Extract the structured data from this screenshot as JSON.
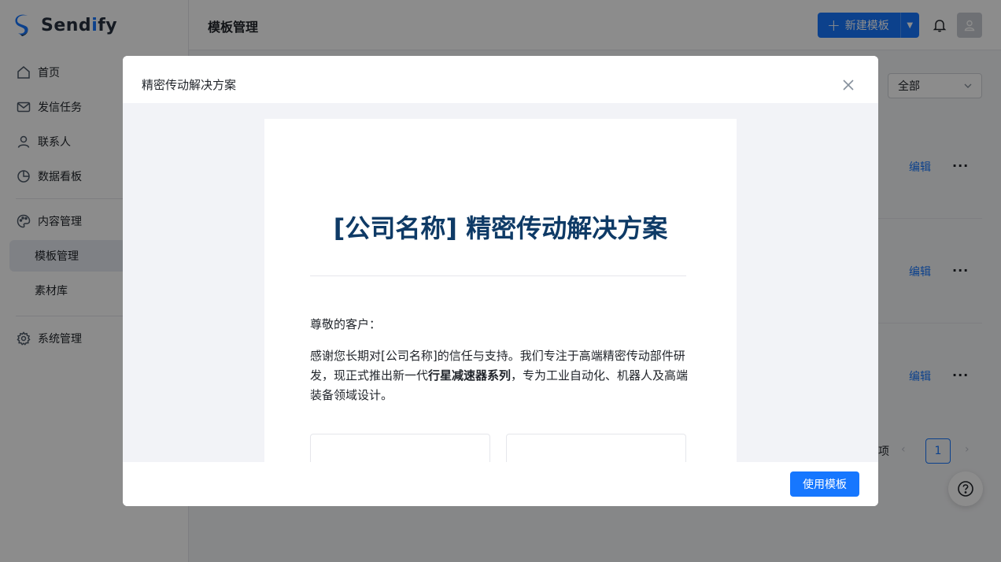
{
  "app": {
    "name_prefix": "Send",
    "name_accent": "i",
    "name_suffix": "fy"
  },
  "sidebar": {
    "items": [
      {
        "label": "首页",
        "icon": "home-icon"
      },
      {
        "label": "发信任务",
        "icon": "mail-icon"
      },
      {
        "label": "联系人",
        "icon": "user-icon"
      },
      {
        "label": "数据看板",
        "icon": "pie-chart-icon"
      },
      {
        "label": "内容管理",
        "icon": "palette-icon"
      },
      {
        "label": "模板管理",
        "sub": true,
        "active": true
      },
      {
        "label": "素材库",
        "sub": true
      },
      {
        "label": "系统管理",
        "icon": "gear-icon"
      }
    ]
  },
  "header": {
    "title": "模板管理",
    "new_button": "新建模板"
  },
  "content": {
    "filter_value": "全部",
    "rows": [
      {
        "edit": "编辑",
        "more": "···"
      },
      {
        "edit": "编辑",
        "more": "···"
      },
      {
        "edit": "编辑",
        "more": "···"
      }
    ],
    "pagination": {
      "suffix": "项",
      "current": "1"
    }
  },
  "modal": {
    "title": "精密传动解决方案",
    "email": {
      "heading": "[公司名称] 精密传动解决方案",
      "greeting": "尊敬的客户：",
      "para_before": "感谢您长期对[公司名称]的信任与支持。我们专注于高端精密传动部件研发，现正式推出新一代",
      "para_bold": "行星减速器系列",
      "para_after": "，专为工业自动化、机器人及高端装备领域设计。"
    },
    "use_button": "使用模板"
  },
  "colors": {
    "primary": "#1677ff",
    "heading": "#0e3a66"
  }
}
